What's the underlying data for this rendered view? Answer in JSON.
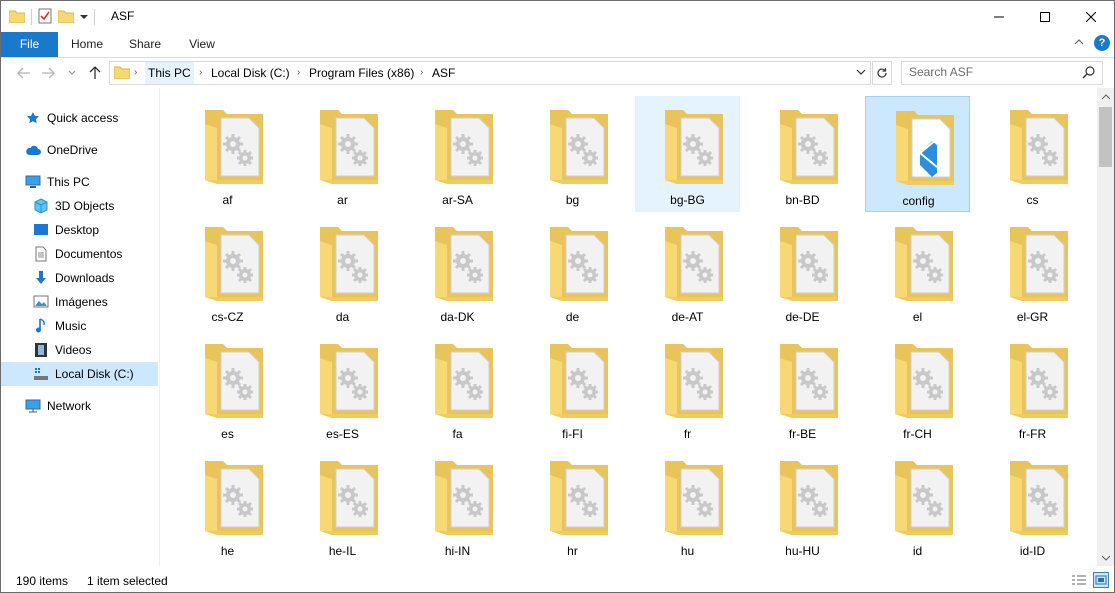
{
  "window": {
    "title": "ASF"
  },
  "ribbon": {
    "tabs": [
      "File",
      "Home",
      "Share",
      "View"
    ]
  },
  "address": {
    "crumbs": [
      "This PC",
      "Local Disk (C:)",
      "Program Files (x86)",
      "ASF"
    ]
  },
  "search": {
    "placeholder": "Search ASF"
  },
  "nav": {
    "items": [
      {
        "label": "Quick access",
        "icon": "star-icon"
      },
      {
        "label": "OneDrive",
        "icon": "cloud-icon"
      },
      {
        "label": "This PC",
        "icon": "computer-icon"
      },
      {
        "label": "3D Objects",
        "icon": "cube-icon"
      },
      {
        "label": "Desktop",
        "icon": "desktop-icon"
      },
      {
        "label": "Documentos",
        "icon": "document-icon"
      },
      {
        "label": "Downloads",
        "icon": "download-arrow-icon"
      },
      {
        "label": "Imágenes",
        "icon": "picture-icon"
      },
      {
        "label": "Music",
        "icon": "music-note-icon"
      },
      {
        "label": "Videos",
        "icon": "film-icon"
      },
      {
        "label": "Local Disk (C:)",
        "icon": "drive-icon"
      },
      {
        "label": "Network",
        "icon": "network-icon"
      }
    ]
  },
  "files": [
    "af",
    "ar",
    "ar-SA",
    "bg",
    "bg-BG",
    "bn-BD",
    "config",
    "cs",
    "cs-CZ",
    "da",
    "da-DK",
    "de",
    "de-AT",
    "de-DE",
    "el",
    "el-GR",
    "es",
    "es-ES",
    "fa",
    "fi-FI",
    "fr",
    "fr-BE",
    "fr-CH",
    "fr-FR",
    "he",
    "he-IL",
    "hi-IN",
    "hr",
    "hu",
    "hu-HU",
    "id",
    "id-ID"
  ],
  "selected_file": "config",
  "hovered_file": "bg-BG",
  "status": {
    "count": "190 items",
    "selection": "1 item selected"
  },
  "colors": {
    "accent": "#1979ca",
    "selection": "#cce8ff",
    "folder": "#f8d775"
  }
}
